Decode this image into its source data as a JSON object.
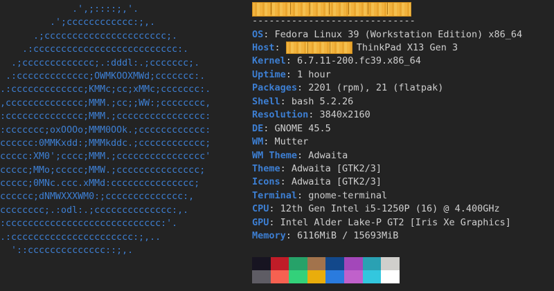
{
  "logo": {
    "lines": [
      "             .',;::::;,'.",
      "         .';cccccccccccc:;,.",
      "      .;cccccccccccccccccccccc;.",
      "    .:cccccccccccccccccccccccccc:.",
      "  .;ccccccccccccc;.:dddl:.;ccccccc;.",
      " .:ccccccccccccc;OWMKOOXMWd;ccccccc:.",
      ".:ccccccccccccc;KMMc;cc;xMMc;ccccccc:.",
      ",cccccccccccccc;MMM.;cc;;WW:;cccccccc,",
      ":cccccccccccccc;MMM.;cccccccccccccccc:",
      ":ccccccc;oxOOOo;MMM0OOk.;cccccccccccc:",
      "cccccc:0MMKxdd:;MMMkddc.;cccccccccccc;",
      "ccccc:XM0';cccc;MMM.;cccccccccccccccc'",
      "ccccc;MMo;ccccc;MMW.;ccccccccccccccc;",
      "ccccc;0MNc.ccc.xMMd:ccccccccccccccc;",
      "cccccc;dNMWXXXWM0:;cccccccccccccc:,",
      "cccccccc;.:odl:.;cccccccccccccc:,.",
      ":cccccccccccccccccccccccccccc:'.",
      ".:cccccccccccccccccccccc:;,..",
      "  '::cccccccccccccc::;,."
    ]
  },
  "info": {
    "underline": "-----------------------------",
    "rows": [
      {
        "key": "OS",
        "value": "Fedora Linux 39 (Workstation Edition) x86_64"
      },
      {
        "key": "Host",
        "value": "ThinkPad X13 Gen 3"
      },
      {
        "key": "Kernel",
        "value": "6.7.11-200.fc39.x86_64"
      },
      {
        "key": "Uptime",
        "value": "1 hour"
      },
      {
        "key": "Packages",
        "value": "2201 (rpm), 21 (flatpak)"
      },
      {
        "key": "Shell",
        "value": "bash 5.2.26"
      },
      {
        "key": "Resolution",
        "value": "3840x2160"
      },
      {
        "key": "DE",
        "value": "GNOME 45.5"
      },
      {
        "key": "WM",
        "value": "Mutter"
      },
      {
        "key": "WM Theme",
        "value": "Adwaita"
      },
      {
        "key": "Theme",
        "value": "Adwaita [GTK2/3]"
      },
      {
        "key": "Icons",
        "value": "Adwaita [GTK2/3]"
      },
      {
        "key": "Terminal",
        "value": "gnome-terminal"
      },
      {
        "key": "CPU",
        "value": "12th Gen Intel i5-1250P (16) @ 4.400GHz"
      },
      {
        "key": "GPU",
        "value": "Intel Alder Lake-P GT2 [Iris Xe Graphics]"
      },
      {
        "key": "Memory",
        "value": "6116MiB / 15693MiB"
      }
    ]
  },
  "colors": {
    "background": "#232323",
    "accent": "#3d7fd3",
    "text": "#cfcfcf",
    "palette_top": [
      "#171421",
      "#c01c28",
      "#26a269",
      "#a2734c",
      "#12488b",
      "#a347ba",
      "#2aa1b3",
      "#d0cfcc"
    ],
    "palette_bottom": [
      "#5e5c64",
      "#f66151",
      "#33d17a",
      "#e9ad0c",
      "#2a7bde",
      "#c061cb",
      "#33c7de",
      "#ffffff"
    ]
  }
}
